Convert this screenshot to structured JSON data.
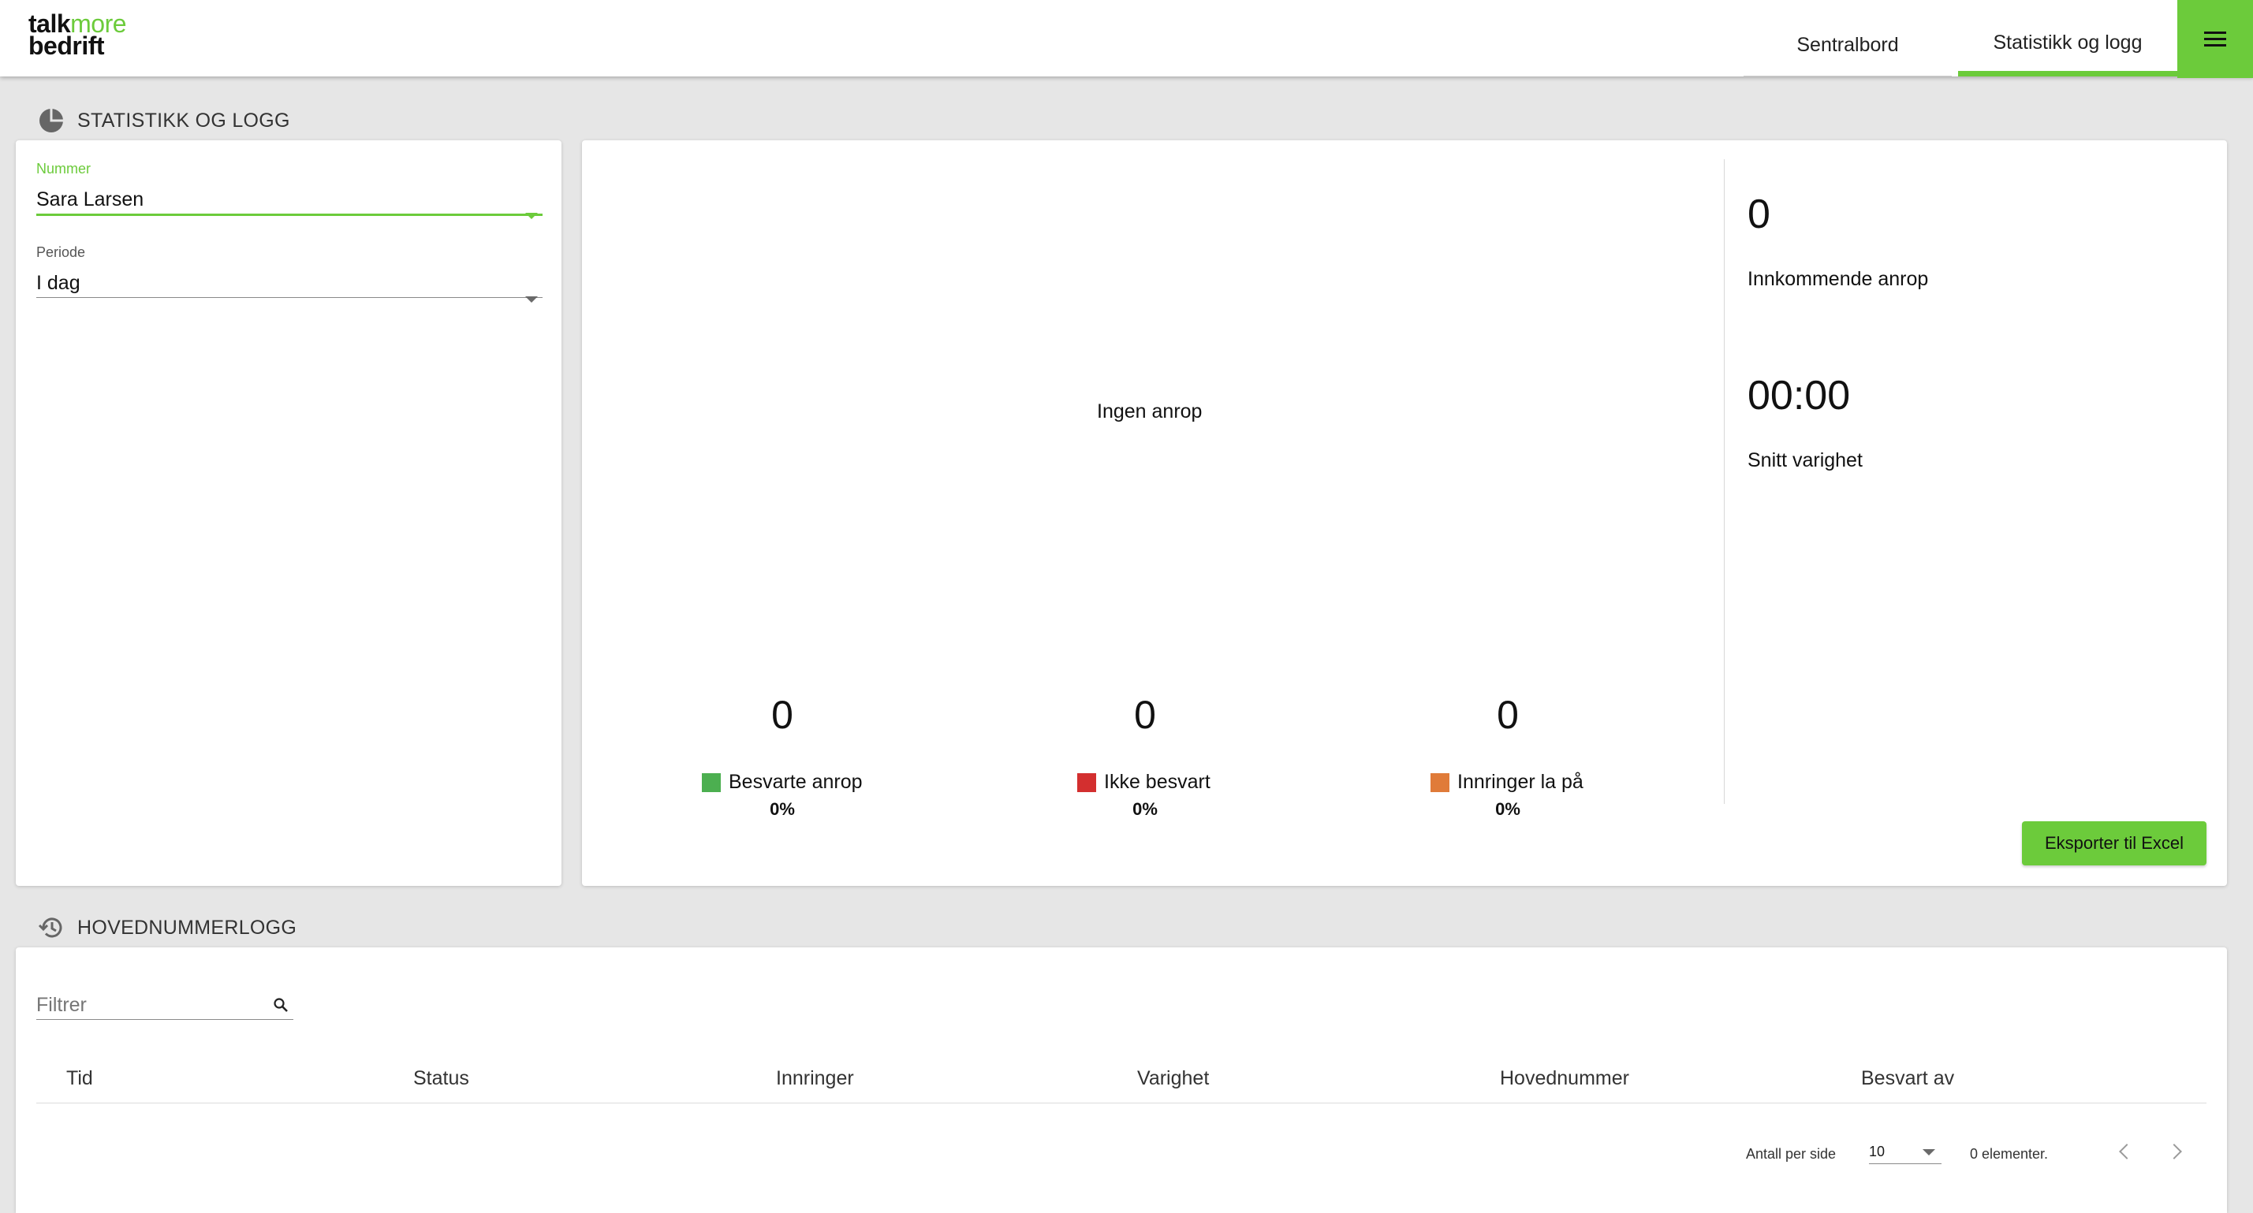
{
  "brand": {
    "line1a": "talk",
    "line1b": "more",
    "line2": "bedrift"
  },
  "nav": {
    "tabs": [
      {
        "label": "Sentralbord"
      },
      {
        "label": "Statistikk og logg"
      }
    ]
  },
  "stats_section": {
    "title": "STATISTIKK OG LOGG"
  },
  "filters": {
    "number": {
      "label": "Nummer",
      "value": "Sara Larsen"
    },
    "period": {
      "label": "Periode",
      "value": "I dag"
    }
  },
  "stats": {
    "empty_message": "Ingen anrop",
    "answered": {
      "count": "0",
      "label": "Besvarte anrop",
      "percent": "0%",
      "color": "#4caf50"
    },
    "not_answered": {
      "count": "0",
      "label": "Ikke besvart",
      "percent": "0%",
      "color": "#d32f2f"
    },
    "hung_up": {
      "count": "0",
      "label": "Innringer la på",
      "percent": "0%",
      "color": "#e07b39"
    },
    "incoming": {
      "value": "0",
      "label": "Innkommende anrop"
    },
    "avg_duration": {
      "value": "00:00",
      "label": "Snitt varighet"
    },
    "export_label": "Eksporter til Excel"
  },
  "log_section": {
    "title": "HOVEDNUMMERLOGG",
    "filter_placeholder": "Filtrer",
    "columns": [
      "Tid",
      "Status",
      "Innringer",
      "Varighet",
      "Hovednummer",
      "Besvart av"
    ],
    "per_page_label": "Antall per side",
    "per_page_value": "10",
    "count_text": "0 elementer."
  },
  "colors": {
    "accent": "#6ccb3b"
  }
}
